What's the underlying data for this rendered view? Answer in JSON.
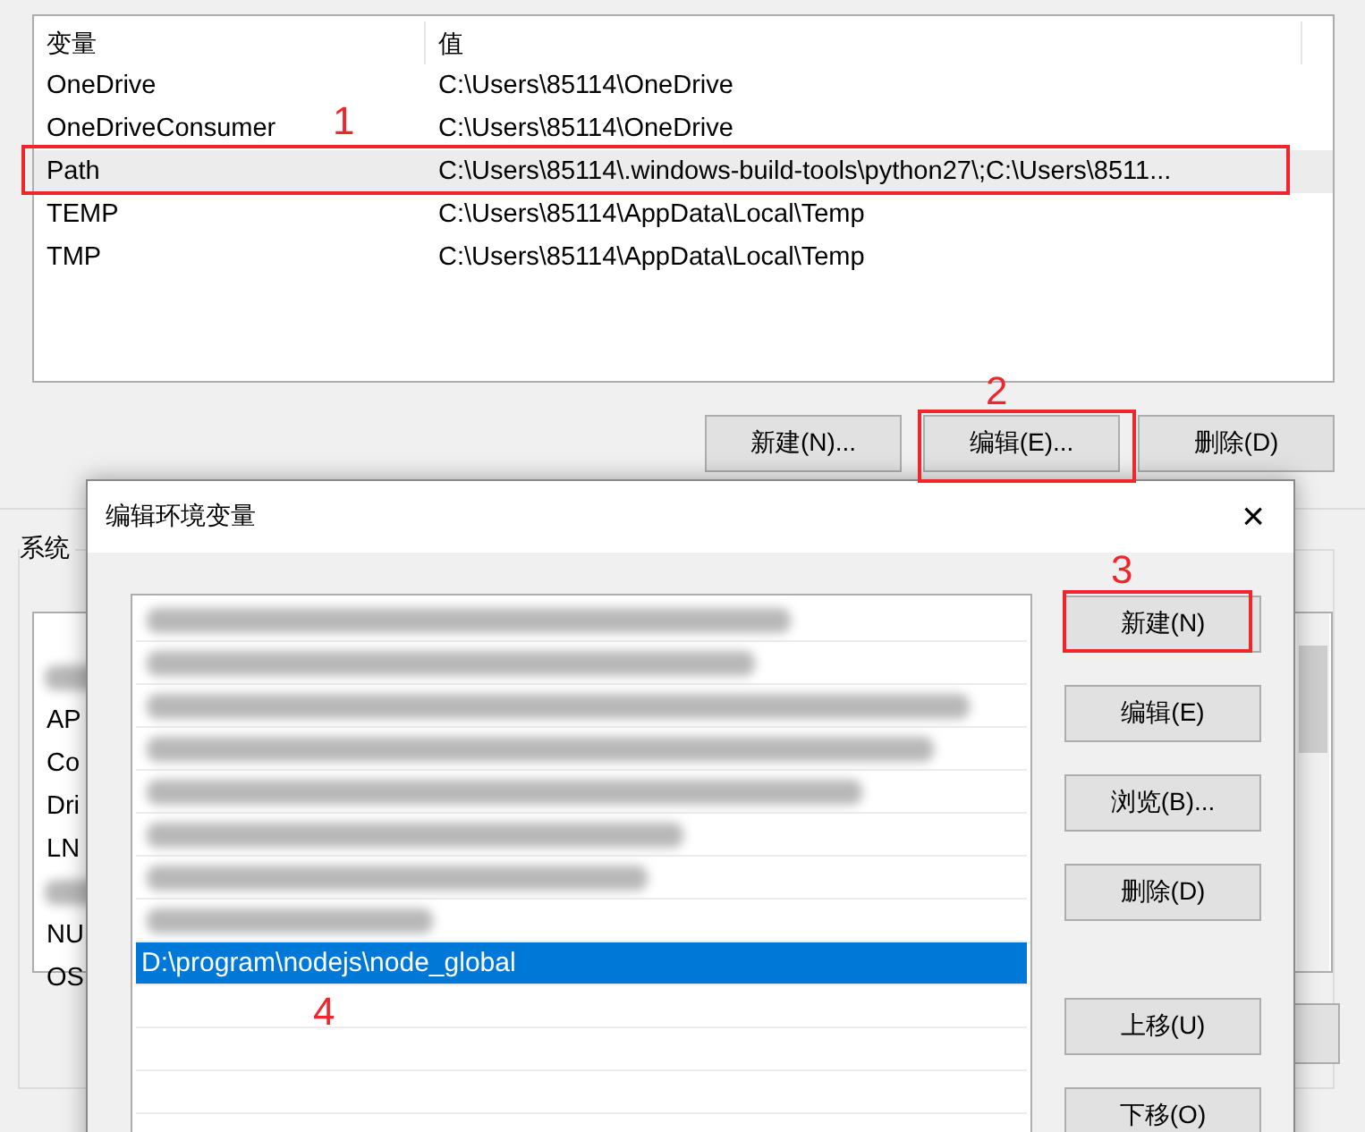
{
  "user_variables": {
    "columns": [
      "变量",
      "值"
    ],
    "rows": [
      {
        "name": "OneDrive",
        "value": "C:\\Users\\85114\\OneDrive",
        "selected": false
      },
      {
        "name": "OneDriveConsumer",
        "value": "C:\\Users\\85114\\OneDrive",
        "selected": false
      },
      {
        "name": "Path",
        "value": "C:\\Users\\85114\\.windows-build-tools\\python27\\;C:\\Users\\8511...",
        "selected": true
      },
      {
        "name": "TEMP",
        "value": "C:\\Users\\85114\\AppData\\Local\\Temp",
        "selected": false
      },
      {
        "name": "TMP",
        "value": "C:\\Users\\85114\\AppData\\Local\\Temp",
        "selected": false
      }
    ],
    "buttons": [
      "新建(N)...",
      "编辑(E)...",
      "删除(D)"
    ]
  },
  "system_variables": {
    "title": "系统",
    "rows": [
      {
        "kind": "redacted"
      },
      {
        "kind": "text",
        "name": "AP"
      },
      {
        "kind": "text",
        "name": "Co"
      },
      {
        "kind": "text",
        "name": "Dri"
      },
      {
        "kind": "text",
        "name": "LN"
      },
      {
        "kind": "redacted"
      },
      {
        "kind": "text",
        "name": "NU"
      },
      {
        "kind": "text",
        "name": "OS"
      }
    ]
  },
  "dialog": {
    "title": "编辑环境变量",
    "close": "×",
    "entries": [
      {
        "kind": "redacted",
        "selected": false
      },
      {
        "kind": "redacted",
        "selected": false
      },
      {
        "kind": "redacted",
        "selected": false
      },
      {
        "kind": "redacted",
        "selected": false
      },
      {
        "kind": "redacted",
        "selected": false
      },
      {
        "kind": "redacted",
        "selected": false
      },
      {
        "kind": "redacted",
        "selected": false
      },
      {
        "kind": "redacted",
        "selected": false
      },
      {
        "kind": "text",
        "text": "D:\\program\\nodejs\\node_global",
        "selected": true
      }
    ],
    "buttons": [
      "新建(N)",
      "编辑(E)",
      "浏览(B)...",
      "删除(D)",
      "上移(U)",
      "下移(O)"
    ]
  },
  "annotations": [
    "1",
    "2",
    "3",
    "4"
  ]
}
